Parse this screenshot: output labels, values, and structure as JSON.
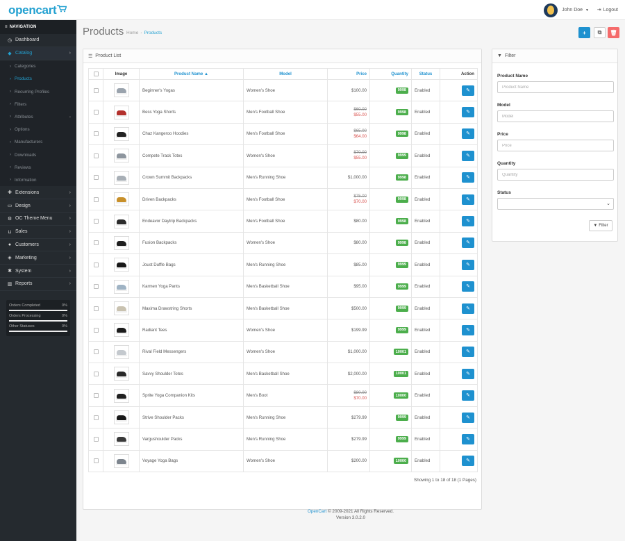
{
  "header": {
    "logo": "opencart",
    "user_name": "John Doe",
    "logout_label": "Logout"
  },
  "sidebar": {
    "nav_heading": "NAVIGATION",
    "menu_top": [
      {
        "label": "Dashboard",
        "icon": "dashboard-icon"
      },
      {
        "label": "Catalog",
        "icon": "tag-icon",
        "active": true
      }
    ],
    "catalog_sub": [
      {
        "label": "Categories"
      },
      {
        "label": "Products",
        "active": true
      },
      {
        "label": "Recurring Profiles"
      },
      {
        "label": "Filters"
      },
      {
        "label": "Attributes",
        "has_children": true
      },
      {
        "label": "Options"
      },
      {
        "label": "Manufacturers"
      },
      {
        "label": "Downloads"
      },
      {
        "label": "Reviews"
      },
      {
        "label": "Information"
      }
    ],
    "menu_bottom": [
      {
        "label": "Extensions",
        "icon": "puzzle-icon"
      },
      {
        "label": "Design",
        "icon": "desktop-icon"
      },
      {
        "label": "OC Theme Menu",
        "icon": "gear-icon"
      },
      {
        "label": "Sales",
        "icon": "cart-icon"
      },
      {
        "label": "Customers",
        "icon": "user-icon"
      },
      {
        "label": "Marketing",
        "icon": "share-icon"
      },
      {
        "label": "System",
        "icon": "cog-icon"
      },
      {
        "label": "Reports",
        "icon": "chart-icon"
      }
    ],
    "stats": [
      {
        "label": "Orders Completed",
        "value": "0%"
      },
      {
        "label": "Orders Processing",
        "value": "0%"
      },
      {
        "label": "Other Statuses",
        "value": "0%"
      }
    ]
  },
  "page": {
    "title": "Products",
    "breadcrumb_home": "Home",
    "breadcrumb_current": "Products"
  },
  "list": {
    "heading": "Product List",
    "columns": {
      "image": "Image",
      "name": "Product Name ▲",
      "model": "Model",
      "price": "Price",
      "quantity": "Quantity",
      "status": "Status",
      "action": "Action"
    },
    "rows": [
      {
        "name": "Beginner's Yogas",
        "model": "Women's Shoe",
        "price": "$100.00",
        "qty": "9998",
        "status": "Enabled",
        "shoe_color": "#9aa3ad"
      },
      {
        "name": "Bess Yoga Shorts",
        "model": "Men's Football Shoe",
        "price": "$60.00",
        "special": "$55.00",
        "qty": "9998",
        "status": "Enabled",
        "shoe_color": "#b3302c"
      },
      {
        "name": "Chaz Kangeroo Hoodies",
        "model": "Men's Football Shoe",
        "price": "$65.00",
        "special": "$64.00",
        "qty": "9998",
        "status": "Enabled",
        "shoe_color": "#222222"
      },
      {
        "name": "Compete Track Totes",
        "model": "Women's Shoe",
        "price": "$70.00",
        "special": "$55.00",
        "qty": "9999",
        "status": "Enabled",
        "shoe_color": "#8d959e"
      },
      {
        "name": "Crown Summit Backpacks",
        "model": "Men's Running Shoe",
        "price": "$1,000.00",
        "qty": "9998",
        "status": "Enabled",
        "shoe_color": "#a8afb6"
      },
      {
        "name": "Driven Backpacks",
        "model": "Men's Football Shoe",
        "price": "$75.00",
        "special": "$70.00",
        "qty": "9998",
        "status": "Enabled",
        "shoe_color": "#c8902a"
      },
      {
        "name": "Endeavor Daytrip Backpacks",
        "model": "Men's Football Shoe",
        "price": "$80.00",
        "qty": "9998",
        "status": "Enabled",
        "shoe_color": "#2b2b2b"
      },
      {
        "name": "Fusion Backpacks",
        "model": "Women's Shoe",
        "price": "$80.00",
        "qty": "9998",
        "status": "Enabled",
        "shoe_color": "#1f1f1f"
      },
      {
        "name": "Joust Duffle Bags",
        "model": "Men's Running Shoe",
        "price": "$85.00",
        "qty": "9999",
        "status": "Enabled",
        "shoe_color": "#181818"
      },
      {
        "name": "Karmen Yoga Pants",
        "model": "Men's Basketball Shoe",
        "price": "$95.00",
        "qty": "9999",
        "status": "Enabled",
        "shoe_color": "#9fb3c4"
      },
      {
        "name": "Maxima Drawstring Shorts",
        "model": "Men's Basketball Shoe",
        "price": "$500.00",
        "qty": "9999",
        "status": "Enabled",
        "shoe_color": "#c9c2b0"
      },
      {
        "name": "Radiant Tees",
        "model": "Women's Shoe",
        "price": "$199.99",
        "qty": "9999",
        "status": "Enabled",
        "shoe_color": "#1c1c1c"
      },
      {
        "name": "Rival Field Messengers",
        "model": "Women's Shoe",
        "price": "$1,000.00",
        "qty": "10001",
        "status": "Enabled",
        "shoe_color": "#c4c9ce"
      },
      {
        "name": "Savvy Shoulder Totes",
        "model": "Men's Basketball Shoe",
        "price": "$2,000.00",
        "qty": "10001",
        "status": "Enabled",
        "shoe_color": "#2a2a2a"
      },
      {
        "name": "Sprite Yoga Companion Kits",
        "model": "Men's Boot",
        "price": "$80.00",
        "special": "$70.00",
        "qty": "10000",
        "status": "Enabled",
        "shoe_color": "#202020"
      },
      {
        "name": "Strive Shoulder Packs",
        "model": "Men's Running Shoe",
        "price": "$279.99",
        "qty": "9999",
        "status": "Enabled",
        "shoe_color": "#1a1a1a"
      },
      {
        "name": "Vargushoulder Packs",
        "model": "Men's Running Shoe",
        "price": "$279.99",
        "qty": "9999",
        "status": "Enabled",
        "shoe_color": "#3a3a3a"
      },
      {
        "name": "Voyage Yoga Bags",
        "model": "Women's Shoe",
        "price": "$200.00",
        "qty": "10000",
        "status": "Enabled",
        "shoe_color": "#7d858e"
      }
    ],
    "showing_text": "Showing 1 to 18 of 18 (1 Pages)"
  },
  "filter": {
    "heading": "Filter",
    "product_name_label": "Product Name",
    "product_name_placeholder": "Product Name",
    "model_label": "Model",
    "model_placeholder": "Model",
    "price_label": "Price",
    "price_placeholder": "Price",
    "quantity_label": "Quantity",
    "quantity_placeholder": "Quantity",
    "status_label": "Status",
    "status_value": "",
    "button_label": "Filter"
  },
  "footer": {
    "link": "OpenCart",
    "copyright": "© 2009-2021 All Rights Reserved.",
    "version": "Version 3.0.2.0"
  }
}
